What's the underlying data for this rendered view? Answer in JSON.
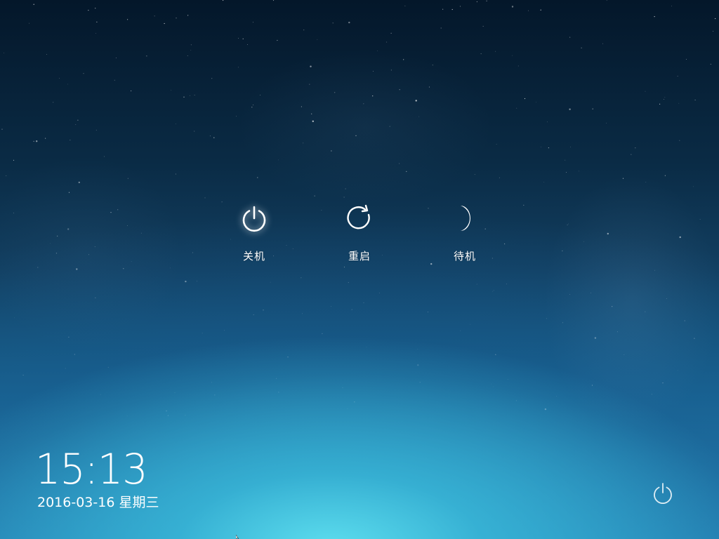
{
  "actions": [
    {
      "id": "shutdown",
      "label": "关机",
      "icon": "power-icon",
      "active": true
    },
    {
      "id": "restart",
      "label": "重启",
      "icon": "restart-icon",
      "active": false
    },
    {
      "id": "suspend",
      "label": "待机",
      "icon": "moon-icon",
      "active": false
    }
  ],
  "clock": {
    "time": "15:13",
    "date": "2016-03-16 星期三"
  },
  "corner": {
    "icon": "power-icon"
  },
  "colors": {
    "text": "#ffffff",
    "sky_top": "#04172a",
    "sky_mid": "#17608c",
    "horizon_glow": "#5fe1f0"
  }
}
